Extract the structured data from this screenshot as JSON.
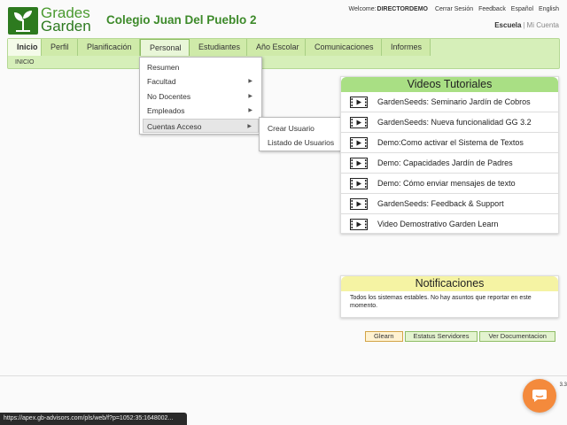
{
  "logo": {
    "line1": "Grades",
    "line2": "Garden"
  },
  "school_name": "Colegio Juan Del Pueblo 2",
  "top_links": {
    "welcome_label": "Welcome:",
    "user": "DIRECTORDEMO",
    "logout": "Cerrar Sesión",
    "feedback": "Feedback",
    "espanol": "Español",
    "english": "English"
  },
  "scope": {
    "active": "Escuela",
    "inactive": "Mi Cuenta"
  },
  "nav": {
    "tabs": [
      "Inicio",
      "Perfil",
      "Planificación",
      "Personal",
      "Estudiantes",
      "Año Escolar",
      "Comunicaciones",
      "Informes"
    ],
    "breadcrumb": "INICIO"
  },
  "personal_menu": {
    "items": [
      {
        "label": "Resumen",
        "has_submenu": false
      },
      {
        "label": "Facultad",
        "has_submenu": true
      },
      {
        "label": "No Docentes",
        "has_submenu": true
      },
      {
        "label": "Empleados",
        "has_submenu": true
      },
      {
        "label": "Cuentas Acceso",
        "has_submenu": true
      }
    ],
    "submenu": [
      "Crear Usuario",
      "Listado de Usuarios"
    ]
  },
  "videos": {
    "title": "Videos Tutoriales",
    "items": [
      "GardenSeeds: Seminario Jardín de Cobros",
      "GardenSeeds: Nueva funcionalidad GG 3.2",
      "Demo:Como activar el Sistema de Textos",
      "Demo: Capacidades Jardín de Padres",
      "Demo: Cómo enviar mensajes de texto",
      "GardenSeeds: Feedback & Support",
      "Video Demostrativo Garden Learn"
    ]
  },
  "notifications": {
    "title": "Notificaciones",
    "text": "Todos los sistemas estables. No hay asuntos que reportar en este momento."
  },
  "buttons": {
    "glearn": "Glearn",
    "status": "Estatus Servidores",
    "docs": "Ver Documentacion"
  },
  "version": "3.3",
  "status_url": "https://apex.gb-advisors.com/pls/web/f?p=1052:35:1648002...",
  "colors": {
    "brand_green": "#2d7a1f",
    "nav_bg": "#d6efb9",
    "videos_header": "#a9df84",
    "notif_header": "#f5f3a3",
    "chat": "#f48a3c"
  },
  "icons": [
    "logo-leaf-icon",
    "video-icon",
    "submenu-arrow-icon",
    "chat-icon"
  ]
}
